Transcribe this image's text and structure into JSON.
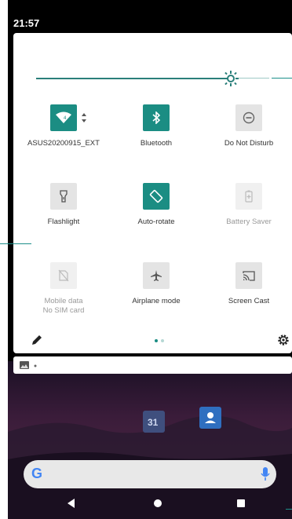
{
  "status_bar": {
    "time": "21:57"
  },
  "colors": {
    "accent": "#1b8d83",
    "tile_off": "#e4e4e4",
    "disabled_text": "#9a9a9a"
  },
  "brightness": {
    "level": 0.74
  },
  "tiles": [
    {
      "label": "ASUS20200915_EXT",
      "sublabel": "",
      "state": "on",
      "icon": "wifi-icon"
    },
    {
      "label": "Bluetooth",
      "sublabel": "",
      "state": "on",
      "icon": "bluetooth-icon"
    },
    {
      "label": "Do Not Disturb",
      "sublabel": "",
      "state": "off",
      "icon": "do-not-disturb-icon"
    },
    {
      "label": "Flashlight",
      "sublabel": "",
      "state": "off",
      "icon": "flashlight-icon"
    },
    {
      "label": "Auto-rotate",
      "sublabel": "",
      "state": "on",
      "icon": "auto-rotate-icon"
    },
    {
      "label": "Battery Saver",
      "sublabel": "",
      "state": "disabled",
      "icon": "battery-saver-icon"
    },
    {
      "label": "Mobile data",
      "sublabel": "No SIM card",
      "state": "disabled",
      "icon": "mobile-data-off-icon"
    },
    {
      "label": "Airplane mode",
      "sublabel": "",
      "state": "off",
      "icon": "airplane-icon"
    },
    {
      "label": "Screen Cast",
      "sublabel": "",
      "state": "off",
      "icon": "screen-cast-icon"
    }
  ],
  "footer": {
    "edit_icon": "pencil-icon",
    "settings_icon": "gear-icon",
    "page_count": 2,
    "current_page": 1
  },
  "home": {
    "calendar_icon_text": "31"
  },
  "search": {
    "logo": "G"
  }
}
